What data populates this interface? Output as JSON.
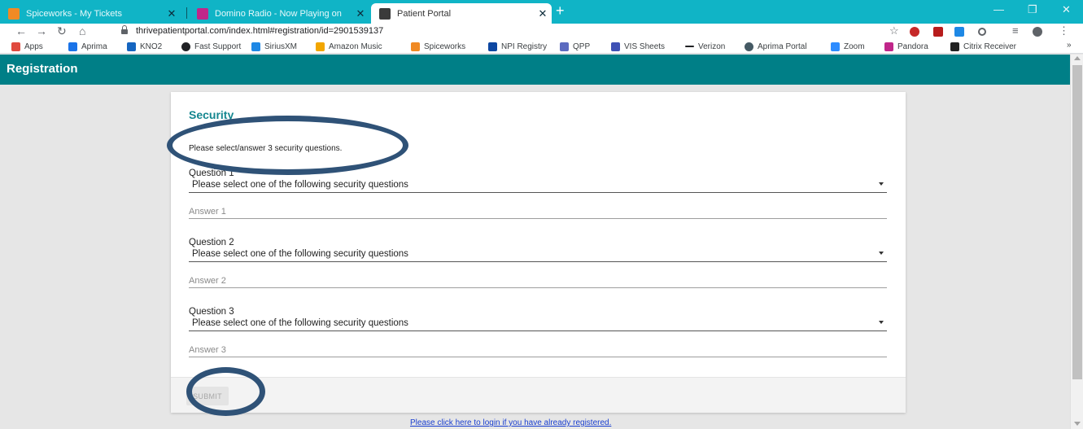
{
  "browser": {
    "tabs": [
      {
        "title": "Spiceworks - My Tickets",
        "icon": "spiceworks-icon",
        "color": "#f08a24",
        "active": false
      },
      {
        "title": "Domino Radio - Now Playing on",
        "icon": "pandora-icon",
        "color": "#c0268a",
        "active": false
      },
      {
        "title": "Patient Portal",
        "icon": "portal-icon",
        "color": "#3a3a3a",
        "active": true
      }
    ],
    "new_tab": "+",
    "url": "thrivepatientportal.com/index.html#registration/id=2901539137",
    "window_controls": {
      "minimize": "—",
      "restore": "❐",
      "close": "✕"
    }
  },
  "bookmarks": [
    {
      "label": "Apps",
      "color": "#e04a3f"
    },
    {
      "label": "Aprima",
      "color": "#1a73e8"
    },
    {
      "label": "KNO2",
      "color": "#1565c0"
    },
    {
      "label": "Fast Support",
      "color": "#202124"
    },
    {
      "label": "SiriusXM",
      "color": "#1e88e5"
    },
    {
      "label": "Amazon Music",
      "color": "#f2a600"
    },
    {
      "label": "Spiceworks",
      "color": "#f08a24"
    },
    {
      "label": "NPI Registry",
      "color": "#0d47a1"
    },
    {
      "label": "QPP",
      "color": "#5c6bc0"
    },
    {
      "label": "VIS Sheets",
      "color": "#3f51b5"
    },
    {
      "label": "Verizon",
      "color": "#202124"
    },
    {
      "label": "Aprima Portal",
      "color": "#455a64"
    },
    {
      "label": "Zoom",
      "color": "#2d8cff"
    },
    {
      "label": "Pandora",
      "color": "#c0268a"
    },
    {
      "label": "Citrix Receiver",
      "color": "#222222"
    }
  ],
  "bookmarks_more": "»",
  "header": {
    "title": "Registration"
  },
  "form": {
    "section_title": "Security",
    "instructions": "Please select/answer 3 security questions.",
    "questions": [
      {
        "label": "Question 1",
        "select_value": "Please select one of the following security questions",
        "answer_placeholder": "Answer 1"
      },
      {
        "label": "Question 2",
        "select_value": "Please select one of the following security questions",
        "answer_placeholder": "Answer 2"
      },
      {
        "label": "Question 3",
        "select_value": "Please select one of the following security questions",
        "answer_placeholder": "Answer 3"
      }
    ],
    "submit_label": "SUBMIT"
  },
  "login_link": "Please click here to login if you have already registered.",
  "colors": {
    "header": "#007f87",
    "accent": "#14868f",
    "tabstrip": "#10b4c6",
    "annotation": "#2f5277"
  }
}
